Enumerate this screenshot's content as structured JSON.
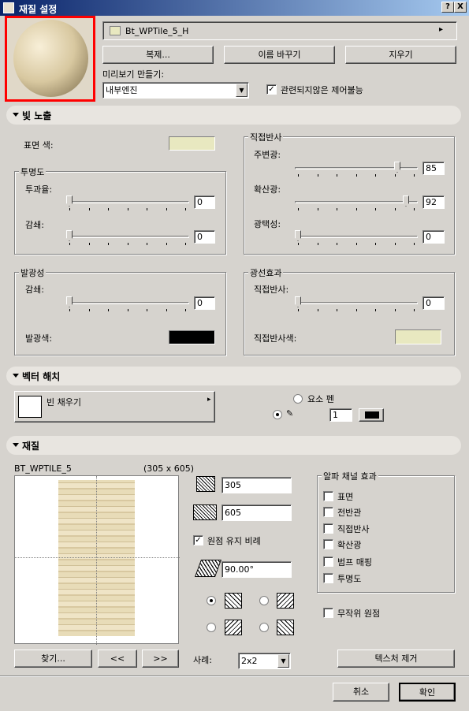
{
  "window": {
    "title": "재질 설정",
    "help": "?",
    "close": "X"
  },
  "material_name": "Bt_WPTile_5_H",
  "buttons": {
    "duplicate": "복제...",
    "rename": "이름 바꾸기",
    "delete": "지우기"
  },
  "preview": {
    "label": "미리보기 만들기:",
    "engine": "내부엔진",
    "control_label": "관련되지않은 제어불능",
    "control_checked": true
  },
  "sections": {
    "light": "빛 노출",
    "hatch": "벡터 해치",
    "texture": "재질"
  },
  "light": {
    "surface_color_label": "표면 색:",
    "surface_color": "#e8e8c0",
    "transparency": {
      "title": "투명도",
      "transmission_label": "투과율:",
      "transmission": "0",
      "falloff_label": "감쇄:",
      "falloff": "0"
    },
    "emission": {
      "title": "발광성",
      "falloff_label": "감쇄:",
      "falloff": "0",
      "color_label": "발광색:",
      "color": "#000000"
    },
    "reflection": {
      "title": "직접반사",
      "ambient_label": "주변광:",
      "ambient": "85",
      "diffuse_label": "확산광:",
      "diffuse": "92",
      "specular_label": "광택성:",
      "specular": "0"
    },
    "ray": {
      "title": "광선효과",
      "reflect_label": "직접반사:",
      "reflect": "0",
      "reflect_color_label": "직접반사색:",
      "reflect_color": "#e8e8c0"
    }
  },
  "hatch": {
    "fill_label": "빈 채우기",
    "element_pen": "요소 펜",
    "pen_value": "1"
  },
  "texture": {
    "name": "BT_WPTILE_5",
    "dims": "(305 x 605)",
    "width": "305",
    "height": "605",
    "keep_ratio_label": "원점 유지 비례",
    "keep_ratio_checked": true,
    "angle": "90.00°",
    "alpha": {
      "title": "알파 채널 효과",
      "items": [
        "표면",
        "전반관",
        "직접반사",
        "확산광",
        "범프 매핑",
        "투명도"
      ]
    },
    "random_origin": "무작위 원점",
    "find": "찾기...",
    "prev": "<<",
    "next": ">>",
    "ratio_label": "사례:",
    "ratio_value": "2x2",
    "remove": "텍스처 제거"
  },
  "footer": {
    "cancel": "취소",
    "ok": "확인"
  },
  "colors": {
    "highlight": "#ff0000"
  }
}
